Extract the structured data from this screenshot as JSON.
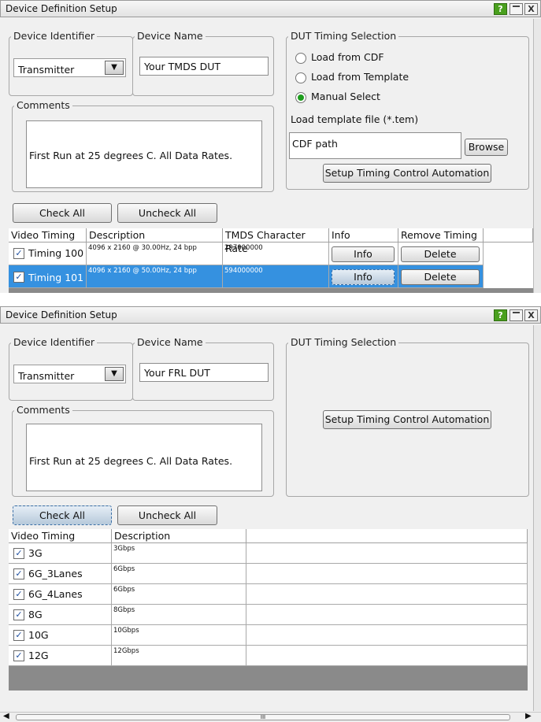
{
  "top": {
    "window_title": "Device Definition Setup",
    "help_label": "?",
    "close_label": "X",
    "device_identifier_legend": "Device Identifier",
    "device_identifier_value": "Transmitter",
    "device_name_legend": "Device Name",
    "device_name_value": "Your TMDS DUT",
    "comments_legend": "Comments",
    "comments_value": "First Run at 25 degrees C.  All Data Rates.",
    "dut_legend": "DUT Timing Selection",
    "radio_cdf": "Load from CDF",
    "radio_template": "Load from Template",
    "radio_manual": "Manual Select",
    "selected_radio": "Manual Select",
    "load_template_label": "Load template file (*.tem)",
    "cdf_path_value": "CDF path",
    "browse_label": "Browse",
    "automation_label": "Setup Timing Control Automation",
    "check_all_label": "Check All",
    "uncheck_all_label": "Uncheck All",
    "columns": [
      "Video Timing",
      "Description",
      "TMDS Character Rate",
      "Info",
      "Remove Timing"
    ],
    "rows": [
      {
        "timing": "Timing 100",
        "description": "4096 x 2160 @ 30.00Hz, 24 bpp",
        "rate": "297000000",
        "info": "Info",
        "remove": "Delete",
        "checked": true,
        "selected": false
      },
      {
        "timing": "Timing 101",
        "description": "4096 x 2160 @ 50.00Hz, 24 bpp",
        "rate": "594000000",
        "info": "Info",
        "remove": "Delete",
        "checked": true,
        "selected": true
      }
    ]
  },
  "bottom": {
    "window_title": "Device Definition Setup",
    "help_label": "?",
    "close_label": "X",
    "device_identifier_legend": "Device Identifier",
    "device_identifier_value": "Transmitter",
    "device_name_legend": "Device Name",
    "device_name_value": "Your FRL DUT",
    "comments_legend": "Comments",
    "comments_value": "First Run at 25 degrees C.  All Data Rates.",
    "dut_legend": "DUT Timing Selection",
    "automation_label": "Setup Timing Control Automation",
    "check_all_label": "Check All",
    "uncheck_all_label": "Uncheck All",
    "columns": [
      "Video Timing",
      "Description"
    ],
    "rows": [
      {
        "timing": "3G",
        "description": "3Gbps",
        "checked": true
      },
      {
        "timing": "6G_3Lanes",
        "description": "6Gbps",
        "checked": true
      },
      {
        "timing": "6G_4Lanes",
        "description": "6Gbps",
        "checked": true
      },
      {
        "timing": "8G",
        "description": "8Gbps",
        "checked": true
      },
      {
        "timing": "10G",
        "description": "10Gbps",
        "checked": true
      },
      {
        "timing": "12G",
        "description": "12Gbps",
        "checked": true
      }
    ],
    "scroll_thumb_label": "III"
  },
  "colors": {
    "selection": "#3591e0",
    "radio_on": "#1d9d1d",
    "help": "#4aa01e"
  }
}
